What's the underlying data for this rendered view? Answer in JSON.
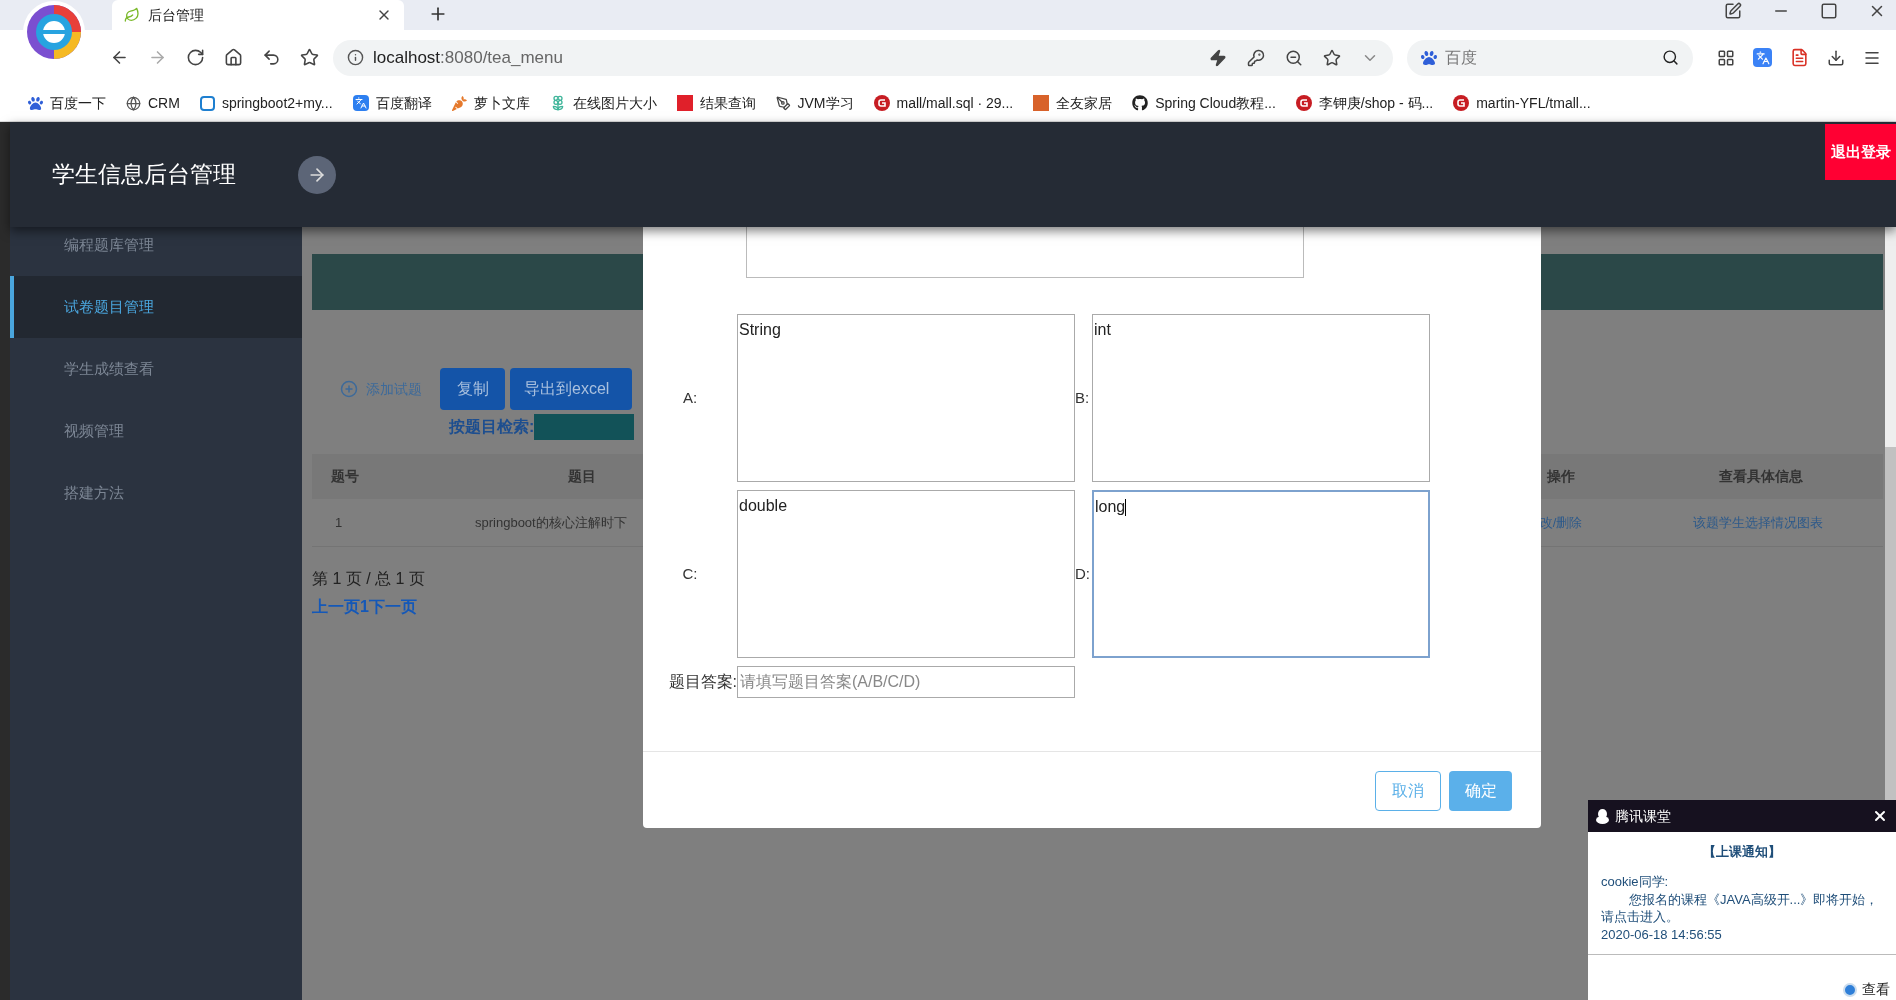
{
  "browser": {
    "tab_title": "后台管理",
    "address_host": "localhost",
    "address_path": ":8080/tea_menu",
    "search_placeholder": "百度",
    "bookmarks": [
      {
        "label": "百度一下",
        "kind": "paw"
      },
      {
        "label": "CRM",
        "kind": "globe"
      },
      {
        "label": "springboot2+my...",
        "kind": "frame"
      },
      {
        "label": "百度翻译",
        "kind": "translate"
      },
      {
        "label": "萝卜文库",
        "kind": "carrot"
      },
      {
        "label": "在线图片大小",
        "kind": "flower"
      },
      {
        "label": "结果查询",
        "kind": "redbox"
      },
      {
        "label": "JVM学习",
        "kind": "pen"
      },
      {
        "label": "mall/mall.sql · 29...",
        "kind": "gitee"
      },
      {
        "label": "全友家居",
        "kind": "orangebox"
      },
      {
        "label": "Spring Cloud教程...",
        "kind": "github"
      },
      {
        "label": "李钾庚/shop - 码...",
        "kind": "gitee"
      },
      {
        "label": "martin-YFL/tmall...",
        "kind": "gitee"
      }
    ]
  },
  "header": {
    "title": "学生信息后台管理",
    "logout": "退出登录"
  },
  "sidebar": {
    "items": [
      {
        "label": "编程题库管理",
        "selected": false
      },
      {
        "label": "试卷题目管理",
        "selected": true
      },
      {
        "label": "学生成绩查看",
        "selected": false
      },
      {
        "label": "视频管理",
        "selected": false
      },
      {
        "label": "搭建方法",
        "selected": false
      }
    ]
  },
  "toolbar": {
    "add": "添加试题",
    "copy": "复制",
    "export": "导出到excel",
    "search_label": "按题目检索:"
  },
  "table": {
    "columns": [
      "题号",
      "题目",
      "操作",
      "查看具体信息"
    ],
    "rows": [
      {
        "number": "1",
        "question": "springboot的核心注解时下",
        "actions": "改/删除",
        "details": "该题学生选择情况图表"
      }
    ]
  },
  "pagination": {
    "summary": "第 1 页 / 总 1 页",
    "links": "上一页1下一页"
  },
  "dialog": {
    "options": [
      {
        "label": "A:",
        "value": "String",
        "focused": false
      },
      {
        "label": "B:",
        "value": "int",
        "focused": false
      },
      {
        "label": "C:",
        "value": "double",
        "focused": false
      },
      {
        "label": "D:",
        "value": "long",
        "focused": true
      }
    ],
    "answer_label": "题目答案:",
    "answer_placeholder": "请填写题目答案(A/B/C/D)",
    "cancel": "取消",
    "confirm": "确定"
  },
  "notification": {
    "title": "腾讯课堂",
    "heading": "【上课通知】",
    "greeting": "cookie同学:",
    "message": "您报名的课程《JAVA高级开...》即将开始，请点击进入。",
    "time": "2020-06-18 14:56:55",
    "action": "查看"
  }
}
